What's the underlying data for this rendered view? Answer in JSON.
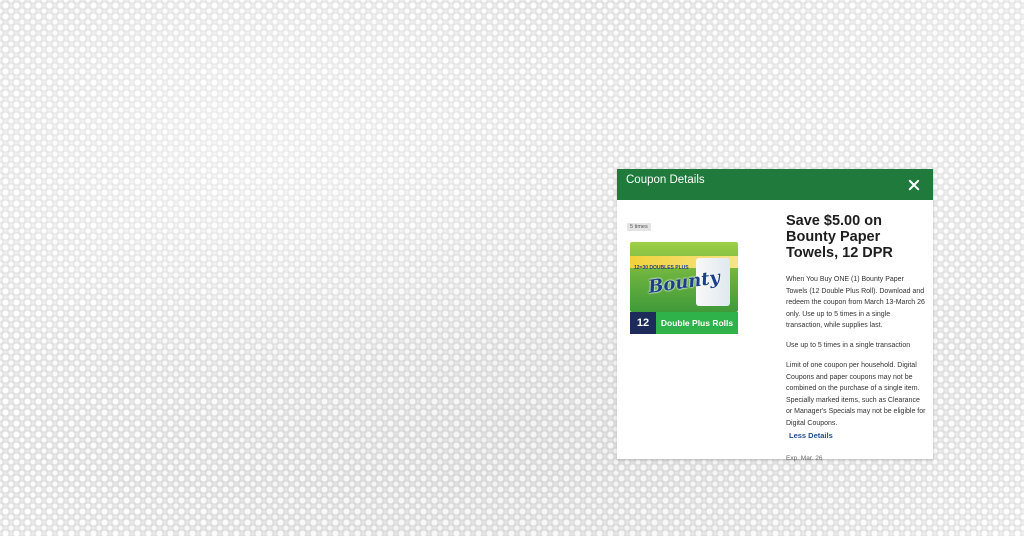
{
  "modal": {
    "title": "Coupon Details",
    "times_badge": "5 times",
    "offer_title": "Save $5.00 on Bounty Paper Towels, 12 DPR",
    "description": "When You Buy ONE (1) Bounty Paper Towels (12 Double Plus Roll). Download and redeem the coupon from March 13-March 26 only. Use up to 5 times in a single transaction, while supplies last.",
    "usage_limit": "Use up to 5 times in a single transaction",
    "terms": "Limit of one coupon per household. Digital Coupons and paper coupons may not be combined on the purchase of a single item. Specially marked items, such as Clearance or Manager's Specials may not be eligible for Digital Coupons.",
    "less_details": "Less Details",
    "expiration": "Exp. Mar. 26"
  },
  "product": {
    "brand": "Bounty",
    "banner": "12=30 DOUBLES PLUS",
    "count": "12",
    "roll_label": "Double Plus Rolls"
  },
  "colors": {
    "header_green": "#1f7a3b",
    "link_blue": "#1f4f8c"
  }
}
